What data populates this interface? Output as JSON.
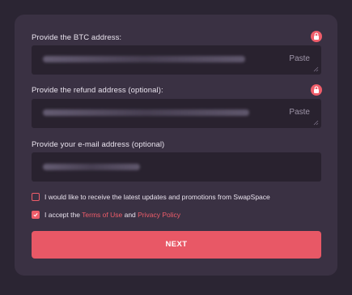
{
  "form": {
    "btc_address": {
      "label": "Provide the BTC address:",
      "paste_label": "Paste"
    },
    "refund_address": {
      "label": "Provide the refund address (optional):",
      "paste_label": "Paste"
    },
    "email": {
      "label": "Provide your e-mail address (optional)",
      "help_symbol": "?"
    },
    "updates_checkbox": {
      "checked": false,
      "label": "I would like to receive the latest updates and promotions from SwapSpace"
    },
    "terms_checkbox": {
      "checked": true,
      "prefix": "I accept the ",
      "terms_link": "Terms of Use",
      "and": " and ",
      "privacy_link": "Privacy Policy"
    },
    "next_button": "NEXT"
  },
  "colors": {
    "accent": "#ef5d6a",
    "panel": "#3a3143",
    "background": "#2b2533",
    "field": "#29222f"
  },
  "icons": [
    "lock-icon",
    "help-icon",
    "checkmark-icon",
    "resize-handle-icon"
  ]
}
